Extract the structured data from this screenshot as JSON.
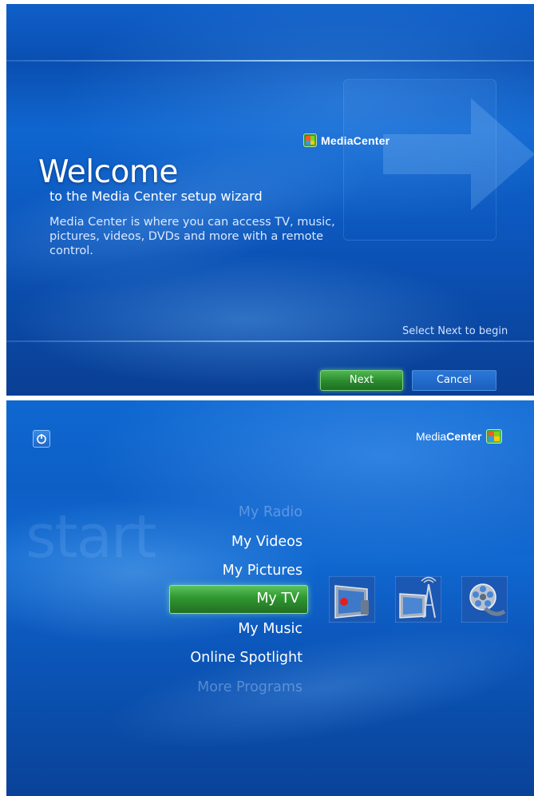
{
  "wizard": {
    "logo_text": "MediaCenter",
    "heading": "Welcome",
    "subtitle": "to the Media Center setup wizard",
    "description": "Media Center is where you can access TV, music, pictures, videos, DVDs and more with a remote control.",
    "hint": "Select Next to begin",
    "next_label": "Next",
    "cancel_label": "Cancel",
    "icons": [
      "media-center-logo-icon",
      "arrow-icon"
    ]
  },
  "start": {
    "logo_prefix": "Media",
    "logo_bold": "Center",
    "background_word": "start",
    "menu": [
      "My Radio",
      "My Videos",
      "My Pictures",
      "My TV",
      "My Music",
      "Online Spotlight",
      "More Programs"
    ],
    "selected": "My TV",
    "tiles": [
      "recorded-tv-icon",
      "live-tv-icon",
      "movies-icon"
    ],
    "icons": [
      "power-icon",
      "windows-flag-icon"
    ]
  },
  "colors": {
    "background_blue": "#0d5fc6",
    "selection_green": "#2f962f",
    "cancel_blue": "#1b5fbd"
  }
}
